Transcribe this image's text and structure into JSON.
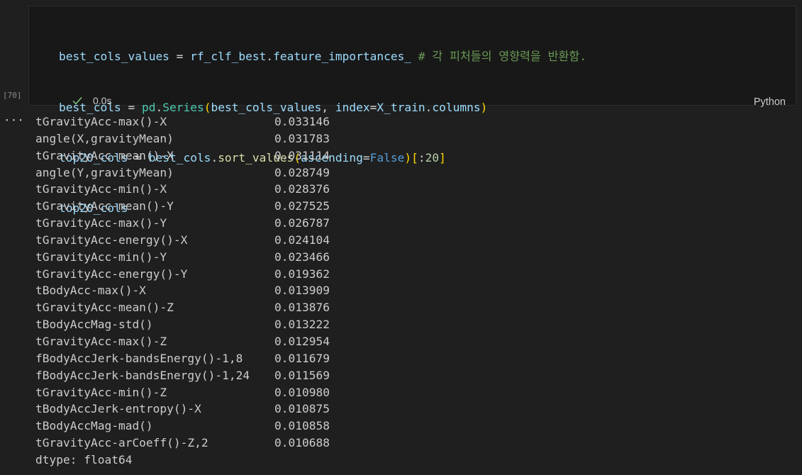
{
  "cell": {
    "execution_count": "[70]",
    "status_time": "0.0s",
    "language": "Python",
    "code": {
      "line1": {
        "var": "best_cols_values",
        "eq": " = ",
        "obj": "rf_clf_best",
        "dot": ".",
        "attr": "feature_importances_",
        "comment": " # 각 피처들의 영향력을 반환함."
      },
      "line2": {
        "var": "best_cols",
        "eq": " = ",
        "mod": "pd",
        "dot": ".",
        "cls": "Series",
        "open": "(",
        "arg1": "best_cols_values",
        "comma": ", ",
        "kw": "index",
        "eq2": "=",
        "obj": "X_train",
        "dot2": ".",
        "attr": "columns",
        "close": ")"
      },
      "line3": {
        "var": "top20_cols",
        "eq": " = ",
        "obj": "best_cols",
        "dot": ".",
        "fn": "sort_values",
        "open": "(",
        "kw": "ascending",
        "eq2": "=",
        "val": "False",
        "close": ")",
        "sopen": "[",
        "colon": ":",
        "num": "20",
        "sclose": "]"
      },
      "line4": {
        "var": "top20_cols"
      }
    }
  },
  "output": {
    "rows": [
      {
        "name": "tGravityAcc-max()-X",
        "value": "0.033146"
      },
      {
        "name": "angle(X,gravityMean)",
        "value": "0.031783"
      },
      {
        "name": "tGravityAcc-mean()-X",
        "value": "0.031114"
      },
      {
        "name": "angle(Y,gravityMean)",
        "value": "0.028749"
      },
      {
        "name": "tGravityAcc-min()-X",
        "value": "0.028376"
      },
      {
        "name": "tGravityAcc-mean()-Y",
        "value": "0.027525"
      },
      {
        "name": "tGravityAcc-max()-Y",
        "value": "0.026787"
      },
      {
        "name": "tGravityAcc-energy()-X",
        "value": "0.024104"
      },
      {
        "name": "tGravityAcc-min()-Y",
        "value": "0.023466"
      },
      {
        "name": "tGravityAcc-energy()-Y",
        "value": "0.019362"
      },
      {
        "name": "tBodyAcc-max()-X",
        "value": "0.013909"
      },
      {
        "name": "tGravityAcc-mean()-Z",
        "value": "0.013876"
      },
      {
        "name": "tBodyAccMag-std()",
        "value": "0.013222"
      },
      {
        "name": "tGravityAcc-max()-Z",
        "value": "0.012954"
      },
      {
        "name": "fBodyAccJerk-bandsEnergy()-1,8",
        "value": "0.011679"
      },
      {
        "name": "fBodyAccJerk-bandsEnergy()-1,24",
        "value": "0.011569"
      },
      {
        "name": "tGravityAcc-min()-Z",
        "value": "0.010980"
      },
      {
        "name": "tBodyAccJerk-entropy()-X",
        "value": "0.010875"
      },
      {
        "name": "tBodyAccMag-mad()",
        "value": "0.010858"
      },
      {
        "name": "tGravityAcc-arCoeff()-Z,2",
        "value": "0.010688"
      }
    ],
    "dtype": "dtype: float64",
    "more_label": "···"
  },
  "colors": {
    "background": "#1f1f1f",
    "cell_background": "#181818",
    "check": "#89d185"
  }
}
